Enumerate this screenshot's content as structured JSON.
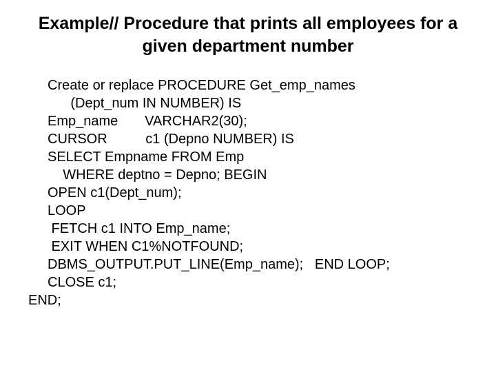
{
  "title": "Example// Procedure that prints all employees for a given department number",
  "code": {
    "l0": "Create or replace PROCEDURE Get_emp_names",
    "l1": "      (Dept_num IN NUMBER) IS",
    "l2": "Emp_name       VARCHAR2(30);",
    "l3": "CURSOR          c1 (Depno NUMBER) IS",
    "l4": "SELECT Empname FROM Emp",
    "l5": "    WHERE deptno = Depno; BEGIN",
    "l6": "OPEN c1(Dept_num);",
    "l7": "LOOP",
    "l8": " FETCH c1 INTO Emp_name;",
    "l9": " EXIT WHEN C1%NOTFOUND;",
    "l10": "DBMS_OUTPUT.PUT_LINE(Emp_name);   END LOOP;",
    "l11": "CLOSE c1;",
    "l12_end": "END;"
  }
}
